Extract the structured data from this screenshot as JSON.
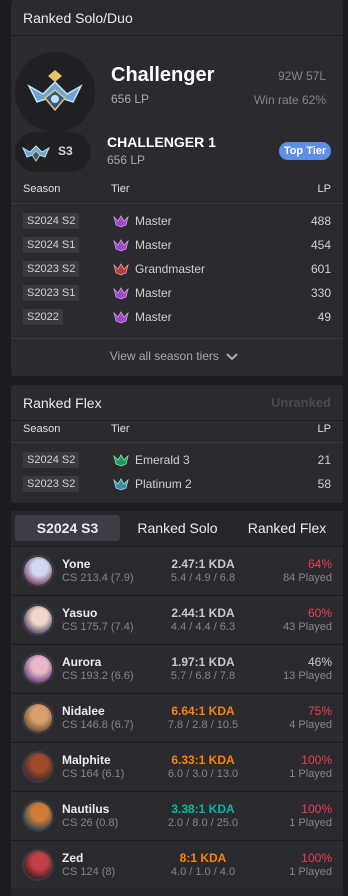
{
  "solo": {
    "title": "Ranked Solo/Duo",
    "tier": "Challenger",
    "lp": "656 LP",
    "wl": "92W 57L",
    "winrate": "Win rate 62%",
    "season_badge": "S3",
    "division": "CHALLENGER 1",
    "division_lp": "656 LP",
    "top_tier": "Top Tier",
    "col_season": "Season",
    "col_tier": "Tier",
    "col_lp": "LP",
    "rows": [
      {
        "season": "S2024 S2",
        "tier": "Master",
        "lp": "488",
        "icon": "master-emblem-icon"
      },
      {
        "season": "S2024 S1",
        "tier": "Master",
        "lp": "454",
        "icon": "master-emblem-icon"
      },
      {
        "season": "S2023 S2",
        "tier": "Grandmaster",
        "lp": "601",
        "icon": "grandmaster-emblem-icon"
      },
      {
        "season": "S2023 S1",
        "tier": "Master",
        "lp": "330",
        "icon": "master-emblem-icon"
      },
      {
        "season": "S2022",
        "tier": "Master",
        "lp": "49",
        "icon": "master-emblem-icon"
      }
    ],
    "view_all": "View all season tiers"
  },
  "flex": {
    "title": "Ranked Flex",
    "status": "Unranked",
    "col_season": "Season",
    "col_tier": "Tier",
    "col_lp": "LP",
    "rows": [
      {
        "season": "S2024 S2",
        "tier": "Emerald 3",
        "lp": "21",
        "icon": "emerald-emblem-icon"
      },
      {
        "season": "S2023 S2",
        "tier": "Platinum 2",
        "lp": "58",
        "icon": "platinum-emblem-icon"
      }
    ]
  },
  "tabs": [
    "S2024 S3",
    "Ranked Solo",
    "Ranked Flex"
  ],
  "champions": [
    {
      "name": "Yone",
      "cs": "CS 213.4 (7.9)",
      "kda": "2.47:1 KDA",
      "kda_detail": "5.4 / 4.9 / 6.8",
      "winrate": "64%",
      "played": "84 Played",
      "kda_color": "#c8c8d0",
      "wr_color": "#e84057"
    },
    {
      "name": "Yasuo",
      "cs": "CS 175.7 (7.4)",
      "kda": "2.44:1 KDA",
      "kda_detail": "4.4 / 4.4 / 6.3",
      "winrate": "60%",
      "played": "43 Played",
      "kda_color": "#c8c8d0",
      "wr_color": "#e84057"
    },
    {
      "name": "Aurora",
      "cs": "CS 193.2 (6.6)",
      "kda": "1.97:1 KDA",
      "kda_detail": "5.7 / 6.8 / 7.8",
      "winrate": "46%",
      "played": "13 Played",
      "kda_color": "#c8c8d0",
      "wr_color": "#c8c8d0"
    },
    {
      "name": "Nidalee",
      "cs": "CS 146.8 (6.7)",
      "kda": "6.64:1 KDA",
      "kda_detail": "7.8 / 2.8 / 10.5",
      "winrate": "75%",
      "played": "4 Played",
      "kda_color": "#ff8200",
      "wr_color": "#e84057"
    },
    {
      "name": "Malphite",
      "cs": "CS 164 (6.1)",
      "kda": "6.33:1 KDA",
      "kda_detail": "6.0 / 3.0 / 13.0",
      "winrate": "100%",
      "played": "1 Played",
      "kda_color": "#ff8200",
      "wr_color": "#e84057"
    },
    {
      "name": "Nautilus",
      "cs": "CS 26 (0.8)",
      "kda": "3.38:1 KDA",
      "kda_detail": "2.0 / 8.0 / 25.0",
      "winrate": "100%",
      "played": "1 Played",
      "kda_color": "#00bba3",
      "wr_color": "#e84057"
    },
    {
      "name": "Zed",
      "cs": "CS 124 (8)",
      "kda": "8:1 KDA",
      "kda_detail": "4.0 / 1.0 / 4.0",
      "winrate": "100%",
      "played": "1 Played",
      "kda_color": "#ff8200",
      "wr_color": "#e84057"
    }
  ],
  "colors": {
    "accent": "#5b8fe8",
    "win": "#e84057",
    "kda_good": "#ff8200",
    "kda_great": "#00bba3"
  }
}
